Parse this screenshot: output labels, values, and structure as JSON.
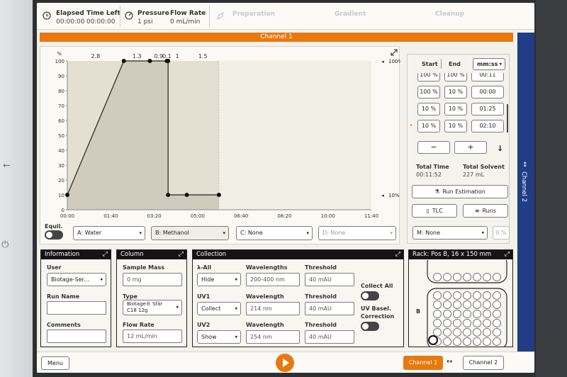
{
  "topbar": {
    "elapsed_label": "Elapsed",
    "elapsed_value": "00:00:00",
    "time_left_label": "Time Left",
    "time_left_value": "00:00:00",
    "pressure_label": "Pressure",
    "pressure_value": "1 psi",
    "flow_rate_label": "Flow Rate",
    "flow_rate_value": "0 mL/min",
    "phase_preparation": "Preparation",
    "phase_gradient": "Gradient",
    "phase_cleanup": "Cleanup"
  },
  "channel_bar": "Channel 1",
  "chart_data": {
    "type": "line",
    "y_unit": "%",
    "ylim": [
      0,
      100
    ],
    "yticks": [
      "100",
      "90",
      "80",
      "70",
      "60",
      "50",
      "40",
      "30",
      "20",
      "10",
      "0"
    ],
    "xticks": [
      "00:00",
      "01:40",
      "03:20",
      "05:00",
      "06:40",
      "08:20",
      "10:00",
      "11:40"
    ],
    "xlim": [
      0,
      700
    ],
    "points": [
      [
        0,
        10
      ],
      [
        130,
        100
      ],
      [
        190,
        100
      ],
      [
        229,
        100
      ],
      [
        232,
        100
      ],
      [
        232,
        10
      ],
      [
        275,
        10
      ],
      [
        349,
        10
      ]
    ],
    "segment_labels": [
      {
        "x": 65,
        "text": "2.8"
      },
      {
        "x": 160,
        "text": "1.3"
      },
      {
        "x": 210,
        "text": "0.9"
      },
      {
        "x": 229,
        "text": "0.1"
      },
      {
        "x": 253,
        "text": "1"
      },
      {
        "x": 312,
        "text": "1.5"
      }
    ],
    "right_labels": {
      "top": "100%",
      "bottom": "10%"
    }
  },
  "equil_label": "Equil.",
  "solvents": [
    {
      "value": "A: Water"
    },
    {
      "value": "B: Methanol"
    },
    {
      "value": "C: None"
    },
    {
      "value": "D: None"
    }
  ],
  "right": {
    "start_label": "Start",
    "end_label": "End",
    "time_format": "mm:ss",
    "rows": [
      [
        "100 %",
        "100 %",
        "00:11"
      ],
      [
        "100 %",
        "10 %",
        "00:00"
      ],
      [
        "10 %",
        "10 %",
        "01:25"
      ],
      [
        "10 %",
        "10 %",
        "02:10"
      ]
    ],
    "minus": "−",
    "plus": "+",
    "down_arrow": "↓",
    "total_time_label": "Total Time",
    "total_time_value": "00:11:52",
    "total_solvent_label": "Total Solvent",
    "total_solvent_value": "227 mL",
    "run_estimation": "Run Estimation",
    "tlc": "TLC",
    "runs": "Runs",
    "modifier": "M: None",
    "modifier_pct": "0 %"
  },
  "info": {
    "title": "Information",
    "user_label": "User",
    "user_value": "Biotage-Ser...",
    "run_name_label": "Run Name",
    "comments_label": "Comments"
  },
  "column": {
    "title": "Column",
    "sample_mass_label": "Sample Mass",
    "sample_mass_value": "0 mg",
    "type_label": "Type",
    "type_value_line1": "Biotage® Sfär",
    "type_value_line2": "C18 12g",
    "flow_rate_label": "Flow Rate",
    "flow_rate_value": "12 mL/min"
  },
  "collection": {
    "title": "Collection",
    "lambda_label": "λ-All",
    "wl_label": "Wavelengths",
    "th_label": "Threshold",
    "lambda_mode": "Hide",
    "lambda_wl": "200-400 nm",
    "lambda_th": "40 mAU",
    "uv1_label": "UV1",
    "uv1_mode": "Collect",
    "uv1_wl_label": "Wavelength",
    "uv1_wl": "214 nm",
    "uv1_th_label": "Threshold",
    "uv1_th": "40 mAU",
    "uv2_label": "UV2",
    "uv2_mode": "Show",
    "uv2_wl_label": "Wavelength",
    "uv2_wl": "254 nm",
    "uv2_th_label": "Threshold",
    "uv2_th": "40 mAU",
    "collect_all": "Collect All",
    "uv_baseline_line1": "UV Basel.",
    "uv_baseline_line2": "Correction"
  },
  "rack": {
    "title": "Rack: Pos B, 16 x 150 mm",
    "row_label": "B"
  },
  "bottom": {
    "menu": "Menu",
    "channel1": "Channel 1",
    "swap": "↔",
    "channel2": "Channel 2"
  },
  "side_tab": "Channel 2",
  "colors": {
    "accent": "#e8790f",
    "side_tab": "#213d86"
  }
}
